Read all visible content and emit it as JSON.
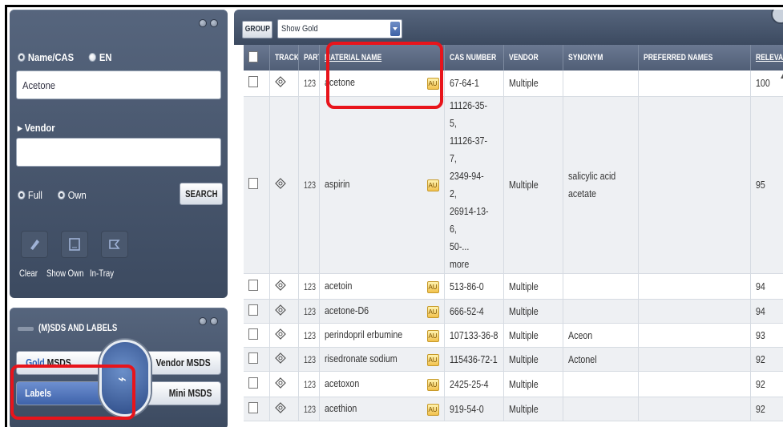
{
  "search": {
    "radio_name_cas": "Name/CAS",
    "radio_en": "EN",
    "query_value": "Acetone",
    "vendor_label": "Vendor",
    "vendor_value": "",
    "radio_full": "Full",
    "radio_own": "Own",
    "search_button": "SEARCH",
    "tools": [
      {
        "label": "Clear",
        "icon": "eraser-icon"
      },
      {
        "label": "Show Own",
        "icon": "document-icon"
      },
      {
        "label": "In-Tray",
        "icon": "tray-icon"
      }
    ]
  },
  "sds": {
    "title": "(M)SDS AND LABELS",
    "gold_prefix": "Gold",
    "gold_suffix": " MSDS",
    "vendor_msds": "Vendor MSDS",
    "labels": "Labels",
    "mini_msds": "Mini MSDS",
    "knob_icon": "pulse-icon"
  },
  "toolbar": {
    "group_label": "GROUP",
    "show_select": "Show Gold"
  },
  "table": {
    "headers": [
      "",
      "TRACK",
      "PART",
      "MATERIAL NAME",
      "CAS NUMBER",
      "VENDOR",
      "SYNONYM",
      "PREFERRED NAMES",
      "RELEVANCE"
    ],
    "rows": [
      {
        "name": "acetone",
        "cas": "67-64-1",
        "vendor": "Multiple",
        "synonym": "",
        "preferred": "",
        "relevance": "100"
      },
      {
        "name": "aspirin",
        "cas_lines": [
          "11126-35-5,",
          "11126-37-7,",
          "2349-94-2,",
          "26914-13-6,",
          "50-...",
          "more"
        ],
        "vendor": "Multiple",
        "synonym_lines": [
          "salicylic acid",
          "acetate"
        ],
        "preferred": "",
        "relevance": "95"
      },
      {
        "name": "acetoin",
        "cas": "513-86-0",
        "vendor": "Multiple",
        "synonym": "",
        "preferred": "",
        "relevance": "94"
      },
      {
        "name": "acetone-D6",
        "cas": "666-52-4",
        "vendor": "Multiple",
        "synonym": "",
        "preferred": "",
        "relevance": "94"
      },
      {
        "name": "perindopril erbumine",
        "cas": "107133-36-8",
        "vendor": "Multiple",
        "synonym": "Aceon",
        "preferred": "",
        "relevance": "93"
      },
      {
        "name": "risedronate sodium",
        "cas": "115436-72-1",
        "vendor": "Multiple",
        "synonym": "Actonel",
        "preferred": "",
        "relevance": "92"
      },
      {
        "name": "acetoxon",
        "cas": "2425-25-4",
        "vendor": "Multiple",
        "synonym": "",
        "preferred": "",
        "relevance": "92"
      },
      {
        "name": "acethion",
        "cas": "919-54-0",
        "vendor": "Multiple",
        "synonym": "",
        "preferred": "",
        "relevance": "92"
      }
    ],
    "part_label": "123",
    "gold_badge": "AU"
  },
  "colors": {
    "panel": "#4a586e",
    "highlight": "#e8141b",
    "labels_active": "#4f72b8"
  }
}
